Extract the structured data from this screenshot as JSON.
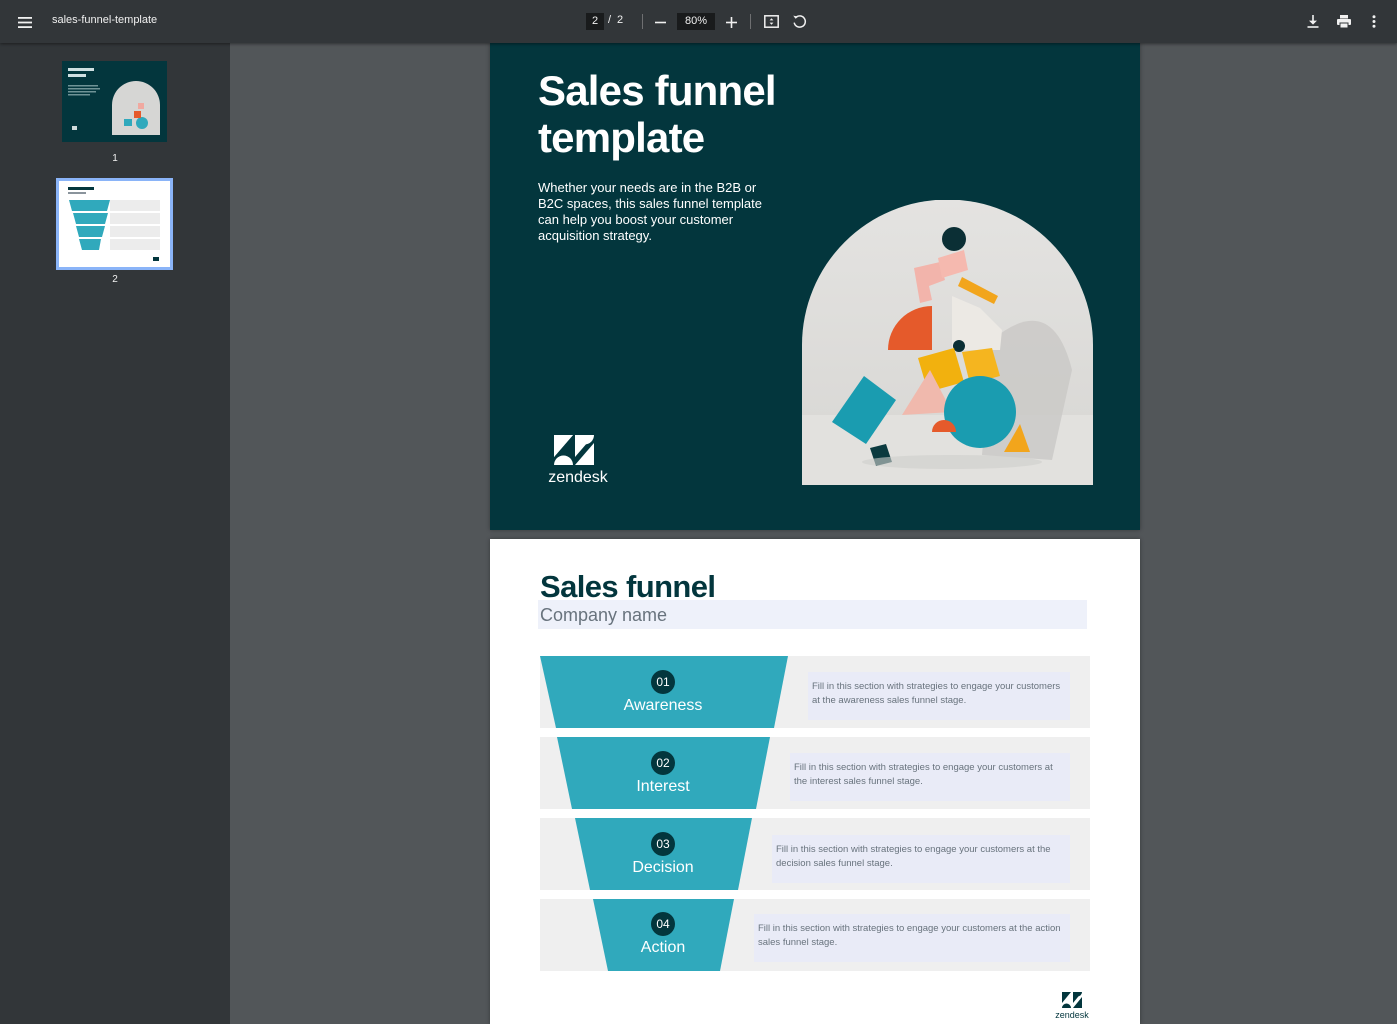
{
  "toolbar": {
    "title": "sales-funnel-template",
    "current_page": "2",
    "page_separator": "/",
    "total_pages": "2",
    "zoom": "80%",
    "icons": [
      "menu-icon",
      "zoom-out-icon",
      "zoom-in-icon",
      "fit-page-icon",
      "rotate-icon",
      "download-icon",
      "print-icon",
      "more-options-icon"
    ]
  },
  "sidebar": {
    "thumbnails": [
      {
        "label": "1",
        "selected": false
      },
      {
        "label": "2",
        "selected": true
      }
    ]
  },
  "page1": {
    "title_line1": "Sales funnel",
    "title_line2": "template",
    "description": "Whether your needs are in the B2B or B2C spaces, this sales funnel template can help you boost your customer acquisition strategy.",
    "logo_text": "zendesk"
  },
  "page2": {
    "title": "Sales funnel",
    "company_placeholder": "Company name",
    "stages": [
      {
        "number": "01",
        "name": "Awareness",
        "text": "Fill in this section with strategies to engage your customers at the awareness sales funnel stage."
      },
      {
        "number": "02",
        "name": "Interest",
        "text": "Fill in this section with strategies to engage your customers at the interest sales funnel stage."
      },
      {
        "number": "03",
        "name": "Decision",
        "text": "Fill in this section with strategies to engage your customers at the decision sales funnel stage."
      },
      {
        "number": "04",
        "name": "Action",
        "text": "Fill in this section with strategies to engage your customers at the action sales funnel stage."
      }
    ],
    "logo_text": "zendesk"
  },
  "colors": {
    "cover_bg": "#03363d",
    "funnel_teal": "#30a9bc",
    "toolbar_bg": "#323639",
    "viewer_bg": "#525659"
  }
}
